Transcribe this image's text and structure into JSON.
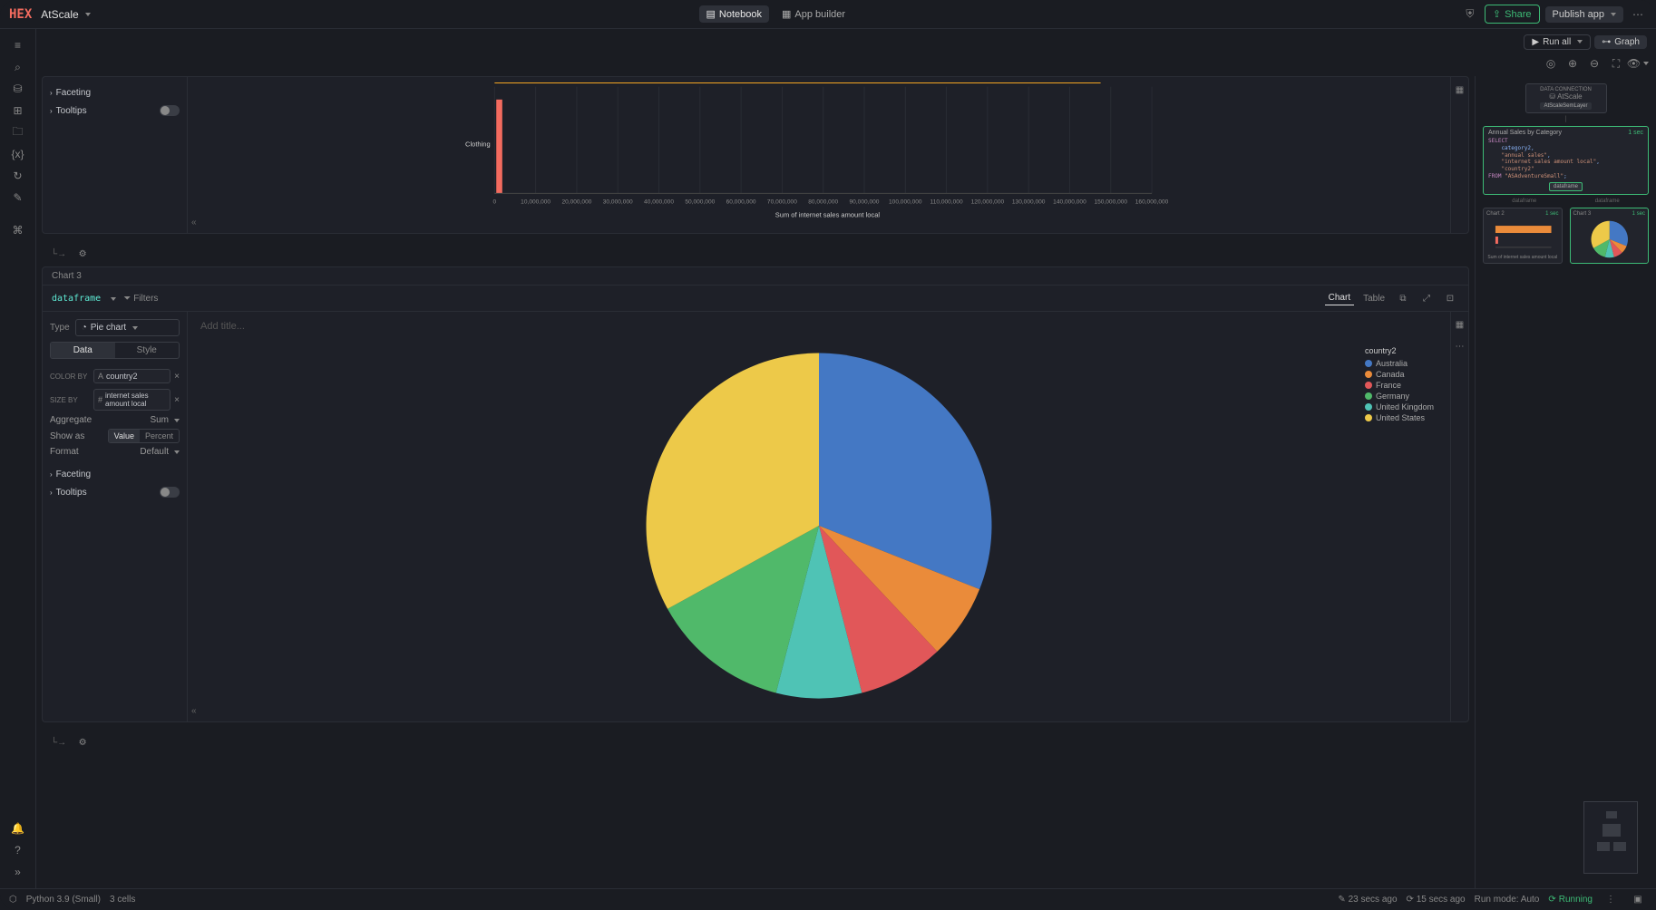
{
  "header": {
    "logo": "HEX",
    "project": "AtScale",
    "notebook": "Notebook",
    "app_builder": "App builder",
    "share": "Share",
    "publish": "Publish app"
  },
  "toolbar": {
    "run_all": "Run all",
    "graph": "Graph"
  },
  "bar_cell": {
    "config": {
      "faceting": "Faceting",
      "tooltips": "Tooltips"
    },
    "y_label": "Clothing",
    "x_title": "Sum of internet sales amount local",
    "ticks": [
      "0",
      "10,000,000",
      "20,000,000",
      "30,000,000",
      "40,000,000",
      "50,000,000",
      "60,000,000",
      "70,000,000",
      "80,000,000",
      "90,000,000",
      "100,000,000",
      "110,000,000",
      "120,000,000",
      "130,000,000",
      "140,000,000",
      "150,000,000",
      "160,000,000"
    ]
  },
  "pie_cell": {
    "title": "Chart 3",
    "dataframe": "dataframe",
    "filters": "Filters",
    "chart_tab": "Chart",
    "table_tab": "Table",
    "add_title": "Add title...",
    "type_label": "Type",
    "type_value": "Pie chart",
    "data_tab": "Data",
    "style_tab": "Style",
    "color_by_label": "COLOR BY",
    "color_by_value": "country2",
    "size_by_label": "SIZE BY",
    "size_by_value": "internet sales amount local",
    "aggregate": "Aggregate",
    "aggregate_val": "Sum",
    "show_as": "Show as",
    "show_as_value": "Value",
    "show_as_percent": "Percent",
    "format": "Format",
    "format_val": "Default",
    "faceting": "Faceting",
    "tooltips": "Tooltips",
    "legend_title": "country2",
    "legend": [
      "Australia",
      "Canada",
      "France",
      "Germany",
      "United Kingdom",
      "United States"
    ],
    "legend_colors": [
      "#4478c4",
      "#ea8b3a",
      "#e15759",
      "#50b96a",
      "#4fc3b5",
      "#edc949"
    ]
  },
  "graph_panel": {
    "data_conn": "DATA CONNECTION",
    "atscale": "AtScale",
    "badge1": "AtScaleSemLayer",
    "sql_title": "Annual Sales by Category",
    "sql_time": "1 sec",
    "sql": "SELECT\n    category2,\n    \"annual sales\",\n    \"internet sales amount local\",\n    \"country2\"\nFROM \"ASAdventureSmall\";",
    "df_badge": "dataframe",
    "chart2": "Chart 2",
    "chart2_time": "1 sec",
    "chart2_x": "Sum of internet sales amount local",
    "chart3": "Chart 3",
    "chart3_time": "1 sec"
  },
  "statusbar": {
    "kernel": "Python 3.9 (Small)",
    "cells": "3 cells",
    "time1": "23 secs ago",
    "time2": "15 secs ago",
    "runmode": "Run mode: Auto",
    "status": "Running"
  },
  "chart_data": [
    {
      "type": "bar",
      "orientation": "horizontal",
      "title": "",
      "xlabel": "Sum of internet sales amount local",
      "ylabel": "",
      "categories": [
        "Clothing"
      ],
      "values": [
        1500000
      ],
      "xlim": [
        0,
        160000000
      ],
      "x_ticks": [
        0,
        10000000,
        20000000,
        30000000,
        40000000,
        50000000,
        60000000,
        70000000,
        80000000,
        90000000,
        100000000,
        110000000,
        120000000,
        130000000,
        140000000,
        150000000,
        160000000
      ],
      "bar_color": "#f36b5f"
    },
    {
      "type": "pie",
      "title": "",
      "legend_title": "country2",
      "series": [
        {
          "name": "Australia",
          "value": 31,
          "color": "#4478c4"
        },
        {
          "name": "Canada",
          "value": 7,
          "color": "#ea8b3a"
        },
        {
          "name": "France",
          "value": 8,
          "color": "#e15759"
        },
        {
          "name": "Germany",
          "value": 8,
          "color": "#4fc3b5"
        },
        {
          "name": "United Kingdom",
          "value": 13,
          "color": "#50b96a"
        },
        {
          "name": "United States",
          "value": 33,
          "color": "#edc949"
        }
      ]
    }
  ]
}
